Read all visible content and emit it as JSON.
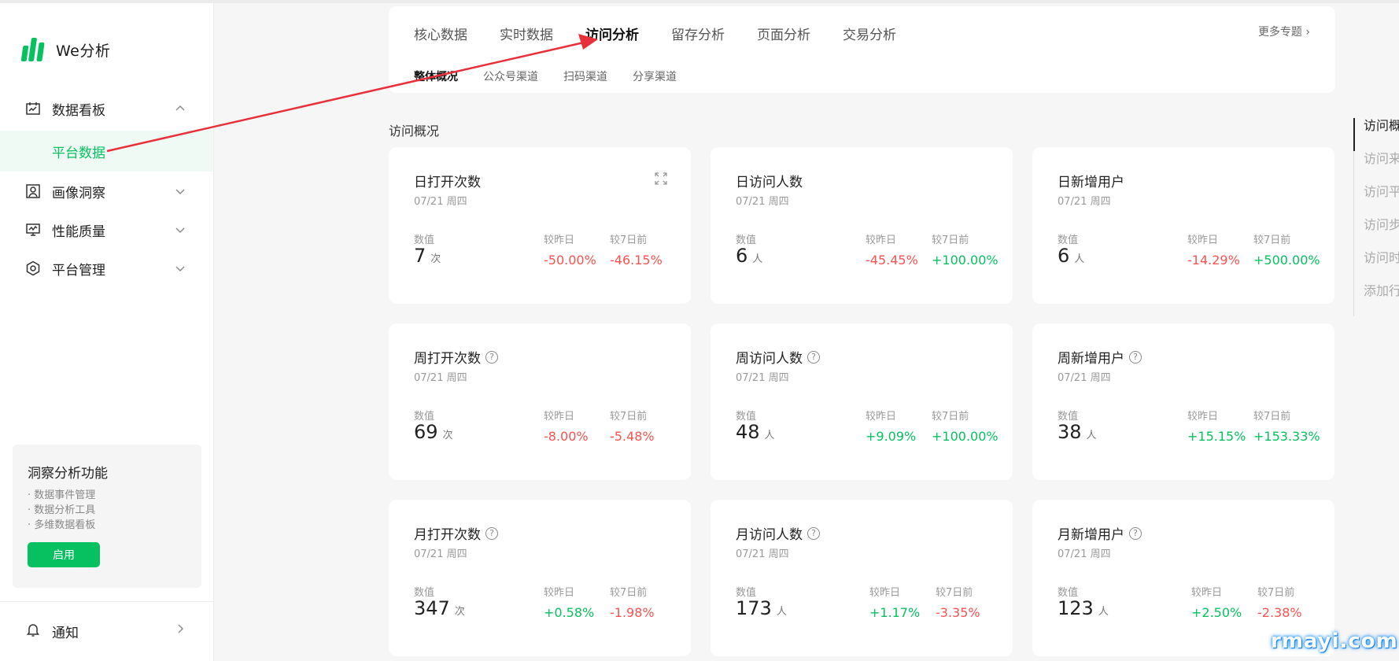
{
  "app": {
    "title": "We分析"
  },
  "sidebar": {
    "nav": [
      {
        "label": "数据看板",
        "icon": "dashboard-icon",
        "expanded": true
      },
      {
        "label": "画像洞察",
        "icon": "portrait-icon",
        "expanded": false
      },
      {
        "label": "性能质量",
        "icon": "monitor-icon",
        "expanded": false
      },
      {
        "label": "平台管理",
        "icon": "settings-hex-icon",
        "expanded": false
      }
    ],
    "active_sub": "平台数据",
    "insight": {
      "title": "洞察分析功能",
      "items": [
        "数据事件管理",
        "数据分析工具",
        "多维数据看板"
      ],
      "button": "启用"
    },
    "notice": "通知"
  },
  "tabs": {
    "main": [
      "核心数据",
      "实时数据",
      "访问分析",
      "留存分析",
      "页面分析",
      "交易分析"
    ],
    "active_main": "访问分析",
    "more": "更多专题",
    "sub": [
      "整体概况",
      "公众号渠道",
      "扫码渠道",
      "分享渠道"
    ],
    "active_sub": "整体概况"
  },
  "section_title": "访问概况",
  "labels": {
    "value": "数值",
    "vs_yesterday": "较昨日",
    "vs_7days": "较7日前"
  },
  "cards": [
    {
      "title": "日打开次数",
      "date": "07/21 周四",
      "value": "7",
      "unit": "次",
      "vs_yesterday": "-50.00%",
      "vs_7days": "-46.15%",
      "help": false,
      "expand": true
    },
    {
      "title": "日访问人数",
      "date": "07/21 周四",
      "value": "6",
      "unit": "人",
      "vs_yesterday": "-45.45%",
      "vs_7days": "+100.00%",
      "help": false,
      "expand": false
    },
    {
      "title": "日新增用户",
      "date": "07/21 周四",
      "value": "6",
      "unit": "人",
      "vs_yesterday": "-14.29%",
      "vs_7days": "+500.00%",
      "help": false,
      "expand": false
    },
    {
      "title": "周打开次数",
      "date": "07/21 周四",
      "value": "69",
      "unit": "次",
      "vs_yesterday": "-8.00%",
      "vs_7days": "-5.48%",
      "help": true,
      "expand": false
    },
    {
      "title": "周访问人数",
      "date": "07/21 周四",
      "value": "48",
      "unit": "人",
      "vs_yesterday": "+9.09%",
      "vs_7days": "+100.00%",
      "help": true,
      "expand": false
    },
    {
      "title": "周新增用户",
      "date": "07/21 周四",
      "value": "38",
      "unit": "人",
      "vs_yesterday": "+15.15%",
      "vs_7days": "+153.33%",
      "help": true,
      "expand": false
    },
    {
      "title": "月打开次数",
      "date": "07/21 周四",
      "value": "347",
      "unit": "次",
      "vs_yesterday": "+0.58%",
      "vs_7days": "-1.98%",
      "help": true,
      "expand": false
    },
    {
      "title": "月访问人数",
      "date": "07/21 周四",
      "value": "173",
      "unit": "人",
      "vs_yesterday": "+1.17%",
      "vs_7days": "-3.35%",
      "help": true,
      "expand": false
    },
    {
      "title": "月新增用户",
      "date": "07/21 周四",
      "value": "123",
      "unit": "人",
      "vs_yesterday": "+2.50%",
      "vs_7days": "-2.38%",
      "help": true,
      "expand": false
    }
  ],
  "anchor_nav": [
    "访问概",
    "访问来",
    "访问平",
    "访问步",
    "访问时",
    "添加行"
  ],
  "colors": {
    "accent": "#07c160",
    "negative": "#fa5151",
    "positive": "#07c160",
    "annotation": "#e8303a"
  },
  "watermark": "rmayi.com"
}
